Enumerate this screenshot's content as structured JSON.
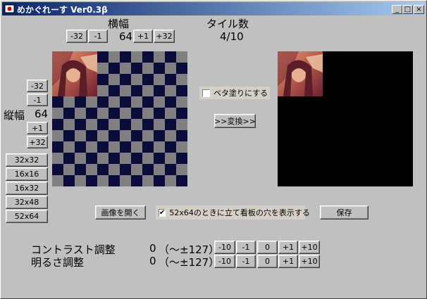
{
  "window": {
    "title": "めかぐれーす Ver0.3β",
    "controls": [
      "_",
      "□",
      "×"
    ]
  },
  "width_section": {
    "label": "横幅",
    "value": "64",
    "buttons": [
      "-32",
      "-1",
      "+1",
      "+32"
    ]
  },
  "tiles_section": {
    "label": "タイル数",
    "value": "4/10"
  },
  "height_section": {
    "label": "縦幅",
    "value": "64",
    "buttons": [
      "-32",
      "-1",
      "+1",
      "+32"
    ]
  },
  "presets": [
    "32x32",
    "16x16",
    "16x32",
    "32x48",
    "52x64"
  ],
  "options": {
    "fill_label": "ベタ塗りにする",
    "fill_checked": false,
    "convert_label": ">>変換>>",
    "open_label": "画像を開く",
    "show_holes_label": "52x64のときに立て看板の穴を表示する",
    "show_holes_checked": true,
    "save_label": "保存"
  },
  "contrast": {
    "label": "コントラスト調整",
    "value": "0",
    "range": "（～±127）",
    "buttons": [
      "-10",
      "-1",
      "0",
      "+1",
      "+10"
    ]
  },
  "brightness": {
    "label": "明るさ調整",
    "value": "0",
    "range": "（～±127）",
    "buttons": [
      "-10",
      "-1",
      "0",
      "+1",
      "+10"
    ]
  },
  "colors": {
    "checker_dark": "#0c0c3c",
    "checker_light": "#808080",
    "output_bg": "#000000"
  }
}
